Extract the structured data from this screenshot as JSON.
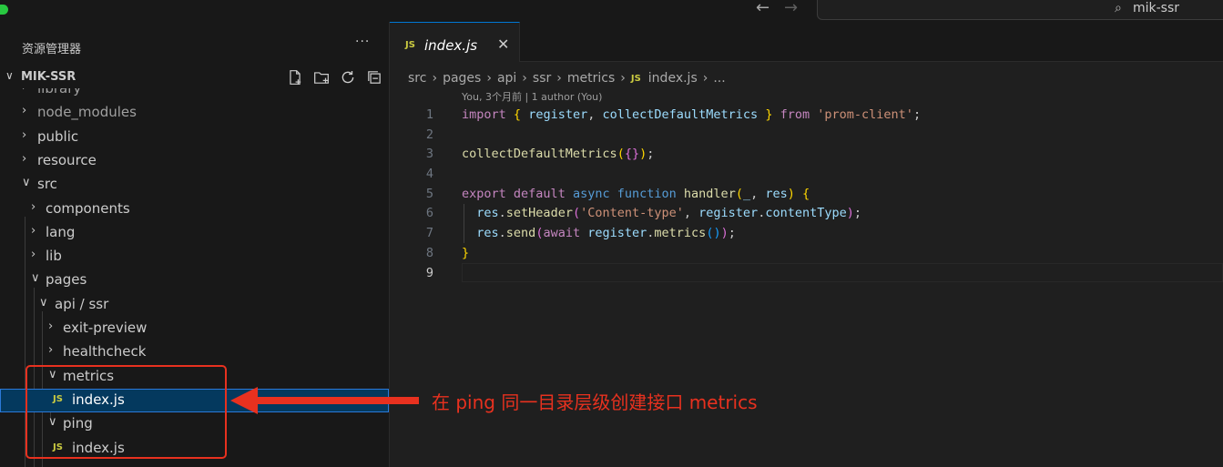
{
  "titlebar": {
    "back_arrow": "←",
    "forward_arrow": "→",
    "search_icon": "⌕",
    "workspace": "mik-ssr"
  },
  "sidebar": {
    "title": "资源管理器",
    "more": "···",
    "section": {
      "chevron": "∨",
      "title": "MIK-SSR",
      "actions": [
        "new-file-icon",
        "new-folder-icon",
        "refresh-icon",
        "collapse-all-icon"
      ]
    },
    "tree": [
      {
        "label": "library",
        "chevron": "›",
        "indent": 0,
        "dim": true
      },
      {
        "label": "node_modules",
        "chevron": "›",
        "indent": 0,
        "dim": true
      },
      {
        "label": "public",
        "chevron": "›",
        "indent": 0
      },
      {
        "label": "resource",
        "chevron": "›",
        "indent": 0
      },
      {
        "label": "src",
        "chevron": "∨",
        "indent": 0
      },
      {
        "label": "components",
        "chevron": "›",
        "indent": 1
      },
      {
        "label": "lang",
        "chevron": "›",
        "indent": 1
      },
      {
        "label": "lib",
        "chevron": "›",
        "indent": 1
      },
      {
        "label": "pages",
        "chevron": "∨",
        "indent": 1
      },
      {
        "label": "api / ssr",
        "chevron": "∨",
        "indent": 2
      },
      {
        "label": "exit-preview",
        "chevron": "›",
        "indent": 3
      },
      {
        "label": "healthcheck",
        "chevron": "›",
        "indent": 3
      },
      {
        "label": "metrics",
        "chevron": "∨",
        "indent": 3
      },
      {
        "label": "index.js",
        "file": true,
        "indent": 4,
        "selected": true
      },
      {
        "label": "ping",
        "chevron": "∨",
        "indent": 3
      },
      {
        "label": "index.js",
        "file": true,
        "indent": 4
      }
    ]
  },
  "editor": {
    "tab": {
      "icon": "JS",
      "label": "index.js",
      "close": "✕"
    },
    "breadcrumb": [
      "src",
      "pages",
      "api",
      "ssr",
      "metrics"
    ],
    "breadcrumb_file": "index.js",
    "breadcrumb_tail": "...",
    "blame": "You, 3个月前 | 1 author (You)",
    "line_numbers": [
      "1",
      "2",
      "3",
      "4",
      "5",
      "6",
      "7",
      "8",
      "9"
    ]
  },
  "file_icon_text": "JS",
  "annotation": {
    "text": "在 ping 同一目录层级创建接口 metrics",
    "color": "#e8311f"
  }
}
